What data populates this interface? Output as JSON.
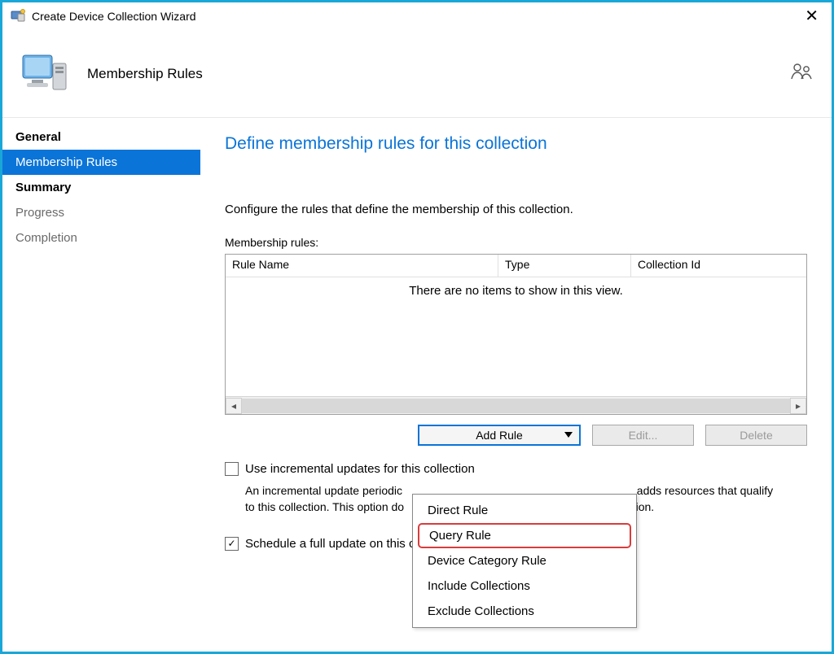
{
  "window": {
    "title": "Create Device Collection Wizard"
  },
  "banner": {
    "title": "Membership Rules"
  },
  "sidebar": {
    "items": [
      {
        "label": "General",
        "state": "bold"
      },
      {
        "label": "Membership Rules",
        "state": "selected"
      },
      {
        "label": "Summary",
        "state": "bold"
      },
      {
        "label": "Progress",
        "state": "muted"
      },
      {
        "label": "Completion",
        "state": "muted"
      }
    ]
  },
  "main": {
    "heading": "Define membership rules for this collection",
    "description": "Configure the rules that define the membership of this collection.",
    "rules_label": "Membership rules:",
    "columns": {
      "rule_name": "Rule Name",
      "type": "Type",
      "collection_id": "Collection Id"
    },
    "empty_text": "There are no items to show in this view.",
    "buttons": {
      "add_rule": "Add Rule",
      "edit": "Edit...",
      "delete": "Delete"
    },
    "incremental": {
      "label": "Use incremental updates for this collection",
      "help_pre": "An incremental update periodic",
      "help_mid": "adds resources that qualify to this collection. This option do",
      "help_post": "date for this collection."
    },
    "schedule": {
      "label": "Schedule a full update on this collection"
    }
  },
  "dropdown": {
    "items": [
      "Direct Rule",
      "Query Rule",
      "Device Category Rule",
      "Include Collections",
      "Exclude Collections"
    ],
    "highlighted_index": 1
  }
}
